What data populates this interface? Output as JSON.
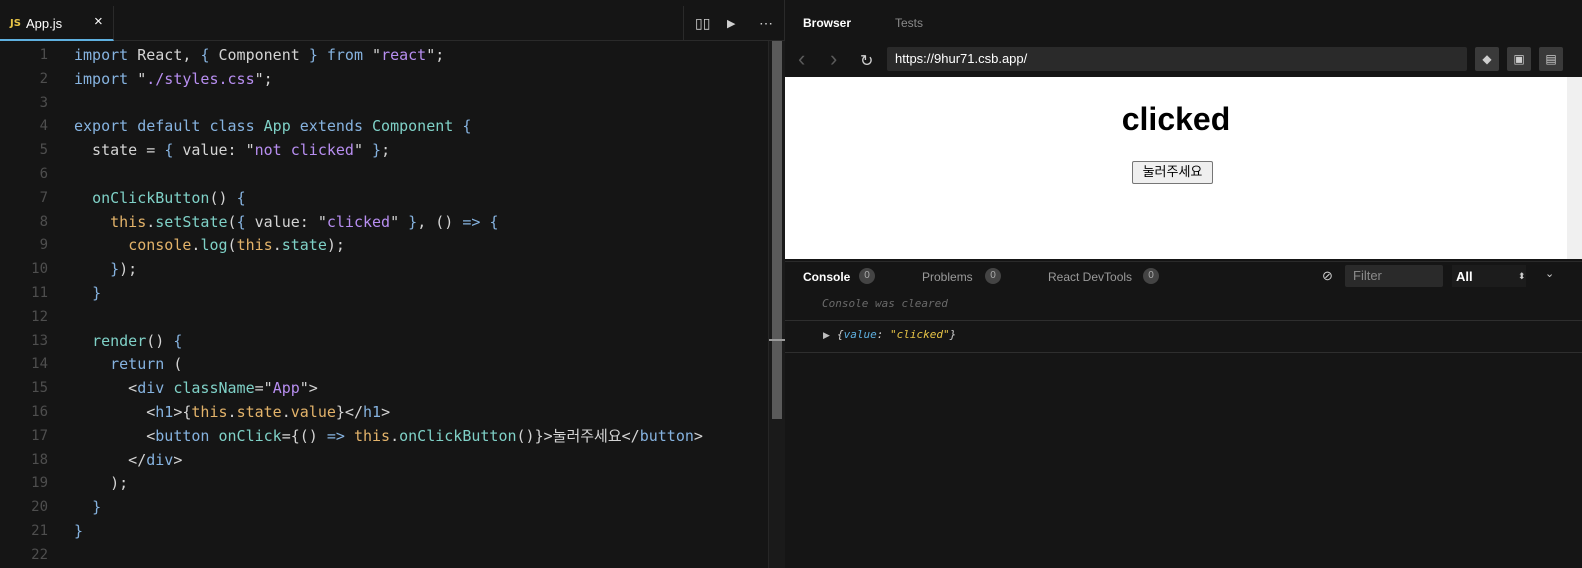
{
  "editor": {
    "tab": {
      "lang_badge": "JS",
      "filename": "App.js",
      "close": "×"
    },
    "actions": [
      "▯▯",
      "▶",
      "⋯"
    ],
    "lines": [
      [
        {
          "t": "import",
          "c": "kw"
        },
        {
          "t": " React, "
        },
        {
          "t": "{",
          "c": "kw"
        },
        {
          "t": " Component "
        },
        {
          "t": "}",
          "c": "kw"
        },
        {
          "t": " "
        },
        {
          "t": "from",
          "c": "kw"
        },
        {
          "t": " \""
        },
        {
          "t": "react",
          "c": "str"
        },
        {
          "t": "\";"
        }
      ],
      [
        {
          "t": "import",
          "c": "kw"
        },
        {
          "t": " \""
        },
        {
          "t": "./styles.css",
          "c": "str"
        },
        {
          "t": "\";"
        }
      ],
      [],
      [
        {
          "t": "export default class",
          "c": "kw"
        },
        {
          "t": " "
        },
        {
          "t": "App",
          "c": "fn"
        },
        {
          "t": " "
        },
        {
          "t": "extends",
          "c": "kw"
        },
        {
          "t": " "
        },
        {
          "t": "Component",
          "c": "fn"
        },
        {
          "t": " "
        },
        {
          "t": "{",
          "c": "kw"
        }
      ],
      [
        {
          "t": "  state = "
        },
        {
          "t": "{",
          "c": "kw"
        },
        {
          "t": " value: \""
        },
        {
          "t": "not clicked",
          "c": "str"
        },
        {
          "t": "\" "
        },
        {
          "t": "}",
          "c": "kw"
        },
        {
          "t": ";"
        }
      ],
      [],
      [
        {
          "t": "  "
        },
        {
          "t": "onClickButton",
          "c": "fn"
        },
        {
          "t": "() "
        },
        {
          "t": "{",
          "c": "kw"
        }
      ],
      [
        {
          "t": "    "
        },
        {
          "t": "this",
          "c": "ob"
        },
        {
          "t": "."
        },
        {
          "t": "setState",
          "c": "fn"
        },
        {
          "t": "("
        },
        {
          "t": "{",
          "c": "kw"
        },
        {
          "t": " value: \""
        },
        {
          "t": "clicked",
          "c": "str"
        },
        {
          "t": "\" "
        },
        {
          "t": "}",
          "c": "kw"
        },
        {
          "t": ", () "
        },
        {
          "t": "=>",
          "c": "kw"
        },
        {
          "t": " "
        },
        {
          "t": "{",
          "c": "kw"
        }
      ],
      [
        {
          "t": "      "
        },
        {
          "t": "console",
          "c": "ob"
        },
        {
          "t": "."
        },
        {
          "t": "log",
          "c": "fn"
        },
        {
          "t": "("
        },
        {
          "t": "this",
          "c": "ob"
        },
        {
          "t": "."
        },
        {
          "t": "state",
          "c": "fn"
        },
        {
          "t": ");"
        }
      ],
      [
        {
          "t": "    "
        },
        {
          "t": "}",
          "c": "kw"
        },
        {
          "t": ");"
        }
      ],
      [
        {
          "t": "  "
        },
        {
          "t": "}",
          "c": "kw"
        }
      ],
      [],
      [
        {
          "t": "  "
        },
        {
          "t": "render",
          "c": "fn"
        },
        {
          "t": "() "
        },
        {
          "t": "{",
          "c": "kw"
        }
      ],
      [
        {
          "t": "    "
        },
        {
          "t": "return",
          "c": "kw"
        },
        {
          "t": " ("
        }
      ],
      [
        {
          "t": "      <"
        },
        {
          "t": "div",
          "c": "tg"
        },
        {
          "t": " "
        },
        {
          "t": "className",
          "c": "fn"
        },
        {
          "t": "=\""
        },
        {
          "t": "App",
          "c": "str"
        },
        {
          "t": "\">"
        }
      ],
      [
        {
          "t": "        <"
        },
        {
          "t": "h1",
          "c": "tg"
        },
        {
          "t": ">{"
        },
        {
          "t": "this",
          "c": "ob"
        },
        {
          "t": "."
        },
        {
          "t": "state",
          "c": "ob"
        },
        {
          "t": "."
        },
        {
          "t": "value",
          "c": "ob"
        },
        {
          "t": "}</"
        },
        {
          "t": "h1",
          "c": "tg"
        },
        {
          "t": ">"
        }
      ],
      [
        {
          "t": "        <"
        },
        {
          "t": "button",
          "c": "tg"
        },
        {
          "t": " "
        },
        {
          "t": "onClick",
          "c": "fn"
        },
        {
          "t": "={() "
        },
        {
          "t": "=>",
          "c": "kw"
        },
        {
          "t": " "
        },
        {
          "t": "this",
          "c": "ob"
        },
        {
          "t": "."
        },
        {
          "t": "onClickButton",
          "c": "fn"
        },
        {
          "t": "()}>눌러주세요</"
        },
        {
          "t": "button",
          "c": "tg"
        },
        {
          "t": ">"
        }
      ],
      [
        {
          "t": "      </"
        },
        {
          "t": "div",
          "c": "tg"
        },
        {
          "t": ">"
        }
      ],
      [
        {
          "t": "    );"
        }
      ],
      [
        {
          "t": "  "
        },
        {
          "t": "}",
          "c": "kw"
        }
      ],
      [
        {
          "t": "}",
          "c": "kw"
        }
      ],
      []
    ]
  },
  "browser": {
    "tabs": [
      {
        "label": "Browser",
        "active": true
      },
      {
        "label": "Tests",
        "active": false
      }
    ],
    "nav": {
      "back": "‹",
      "forward": "›",
      "reload": "↻"
    },
    "url": "https://9hur71.csb.app/",
    "preview": {
      "heading": "clicked",
      "button": "눌러주세요"
    }
  },
  "console": {
    "tabs": [
      {
        "label": "Console",
        "count": "0",
        "active": true
      },
      {
        "label": "Problems",
        "count": "0",
        "active": false
      },
      {
        "label": "React DevTools",
        "count": "0",
        "active": false
      }
    ],
    "filter_placeholder": "Filter",
    "level": "All",
    "cleared_message": "Console was cleared",
    "log": {
      "open": "{",
      "key": "value",
      "sep": ": ",
      "value": "\"clicked\"",
      "close": "}"
    }
  },
  "colors": {
    "accent_tab": "#5fb0e0",
    "keyword": "#86b3e0",
    "string": "#b78ef0",
    "function": "#7fd1c7",
    "object": "#e3b36a",
    "js_badge": "#e8c547"
  }
}
